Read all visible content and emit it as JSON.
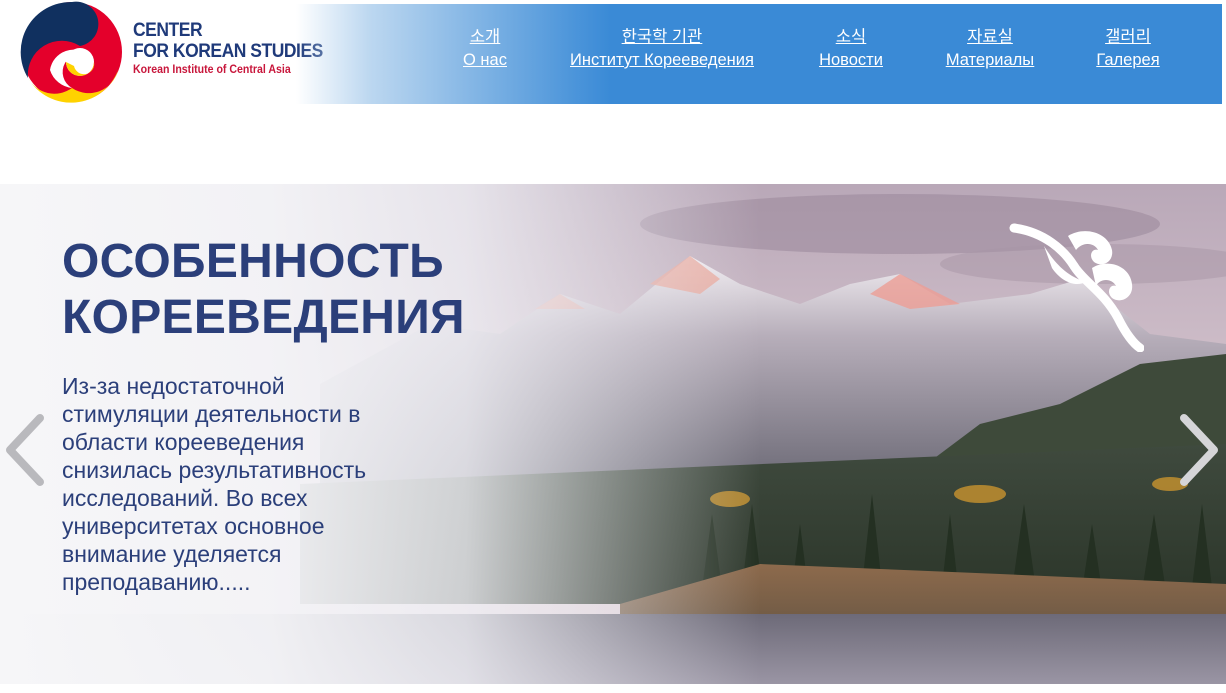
{
  "logo": {
    "line1": "CENTER",
    "line2": "FOR KOREAN STUDIES",
    "line3": "Korean Institute of Central Asia",
    "colors": {
      "red": "#e4002b",
      "navy": "#10305f",
      "yellow": "#ffd200",
      "text": "#1f3a7a"
    }
  },
  "nav": {
    "items": [
      {
        "ko": "소개",
        "ru": "О нас"
      },
      {
        "ko": "한국학 기관",
        "ru": "Институт Корееведения"
      },
      {
        "ko": "소식",
        "ru": "Новости"
      },
      {
        "ko": "자료실",
        "ru": "Материалы"
      },
      {
        "ko": "갤러리",
        "ru": "Галерея"
      }
    ],
    "band_color": "#3a8ad6"
  },
  "hero": {
    "title_line1": "ОСОБЕННОСТЬ",
    "title_line2": "КОРЕЕВЕДЕНИЯ",
    "text": "Из-за недостаточной стимуляции деятельности в области корееведения снизилась результативность исследований. Во всех университетах основное внимание уделяется преподаванию.....",
    "prev_icon": "chevron-left-icon",
    "next_icon": "chevron-right-icon",
    "ornament_icon": "kazakh-ornament-icon",
    "title_color": "#2b3f7a"
  }
}
